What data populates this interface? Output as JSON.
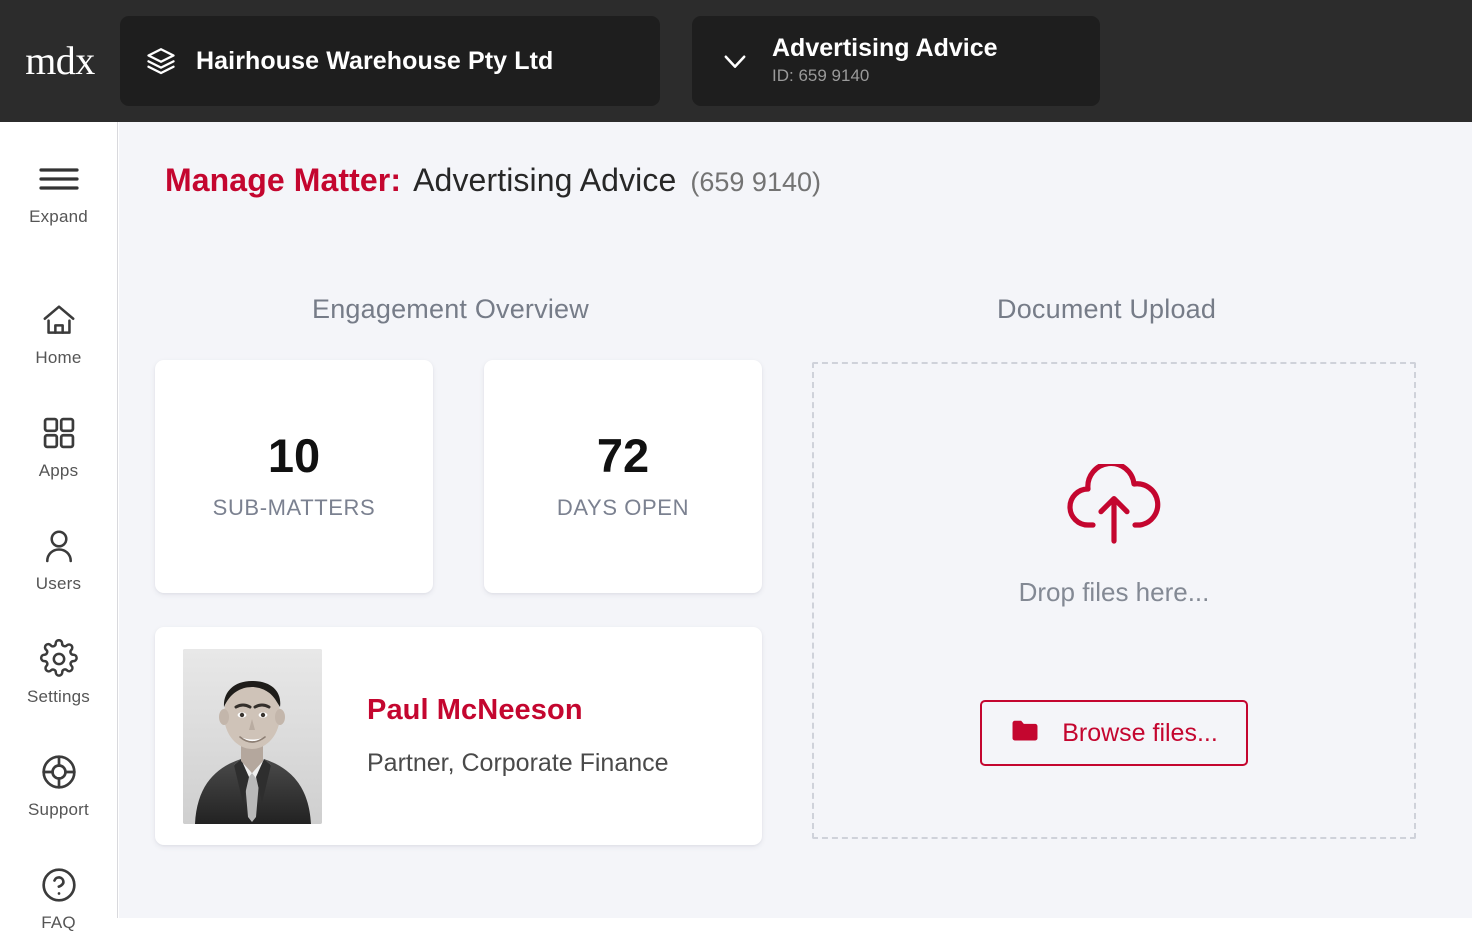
{
  "brand": {
    "logo_text": "mdx",
    "accent_color": "#C4062F",
    "topbar_color": "#2C2C2C",
    "page_bg_color": "#F4F5F9"
  },
  "topbar": {
    "client": {
      "icon": "layers-icon",
      "name": "Hairhouse Warehouse Pty Ltd"
    },
    "matter": {
      "icon": "chevron-down-icon",
      "title": "Advertising Advice",
      "id_label": "ID: 659 9140"
    }
  },
  "sidebar": {
    "items": [
      {
        "icon": "hamburger-icon",
        "label": "Expand"
      },
      {
        "icon": "home-icon",
        "label": "Home"
      },
      {
        "icon": "grid-apps-icon",
        "label": "Apps"
      },
      {
        "icon": "user-icon",
        "label": "Users"
      },
      {
        "icon": "gear-icon",
        "label": "Settings"
      },
      {
        "icon": "lifebuoy-icon",
        "label": "Support"
      },
      {
        "icon": "question-circle-icon",
        "label": "FAQ"
      }
    ]
  },
  "page": {
    "title_prefix": "Manage Matter:",
    "title_name": "Advertising Advice",
    "title_id": "(659 9140)"
  },
  "engagement": {
    "heading": "Engagement Overview",
    "stats": [
      {
        "value": "10",
        "label": "SUB-MATTERS"
      },
      {
        "value": "72",
        "label": "DAYS OPEN"
      }
    ],
    "contact": {
      "avatar": "portrait-photo",
      "name": "Paul McNeeson",
      "role": "Partner, Corporate Finance"
    }
  },
  "upload": {
    "heading": "Document Upload",
    "cloud_icon": "cloud-upload-icon",
    "drop_text": "Drop files here...",
    "browse_icon": "folder-icon",
    "browse_label": "Browse files..."
  }
}
